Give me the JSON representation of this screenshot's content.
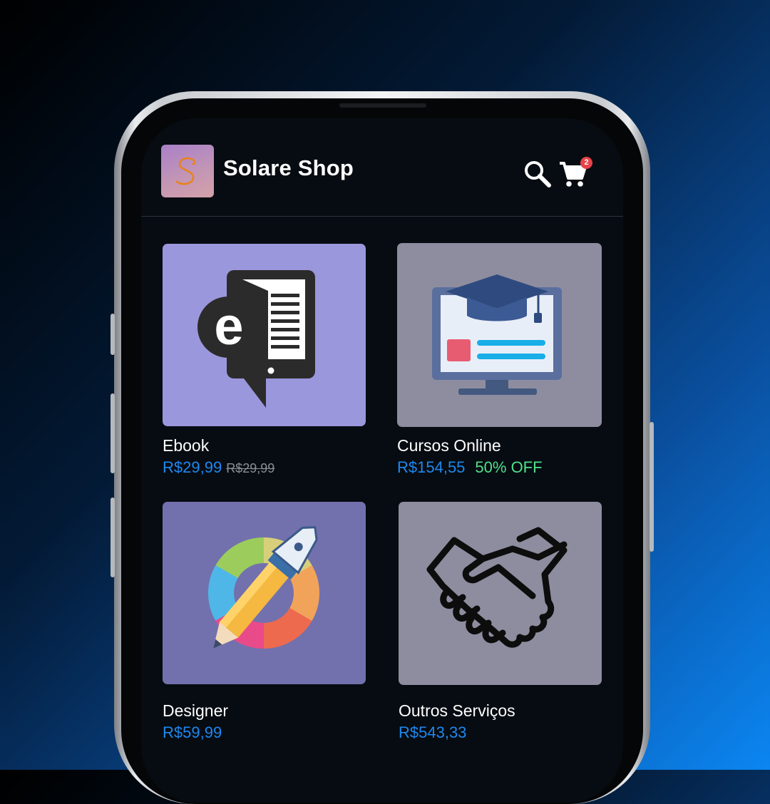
{
  "app": {
    "title": "Solare Shop",
    "logo_letter": "S",
    "cart_count": "2"
  },
  "icons": {
    "search": "search-icon",
    "cart": "shopping-cart-icon"
  },
  "colors": {
    "price": "#1e88f0",
    "discount": "#4fe08a",
    "badge": "#e8424a"
  },
  "products": [
    {
      "name": "Ebook",
      "price": "R$29,99",
      "old_price": "R$29,99",
      "icon": "ebook-icon"
    },
    {
      "name": "Cursos Online",
      "price": "R$154,55",
      "discount": "50% OFF",
      "icon": "online-course-icon"
    },
    {
      "name": "Designer",
      "price": "R$59,99",
      "icon": "design-pen-icon"
    },
    {
      "name": "Outros Serviços",
      "price": "R$543,33",
      "icon": "handshake-icon"
    }
  ]
}
